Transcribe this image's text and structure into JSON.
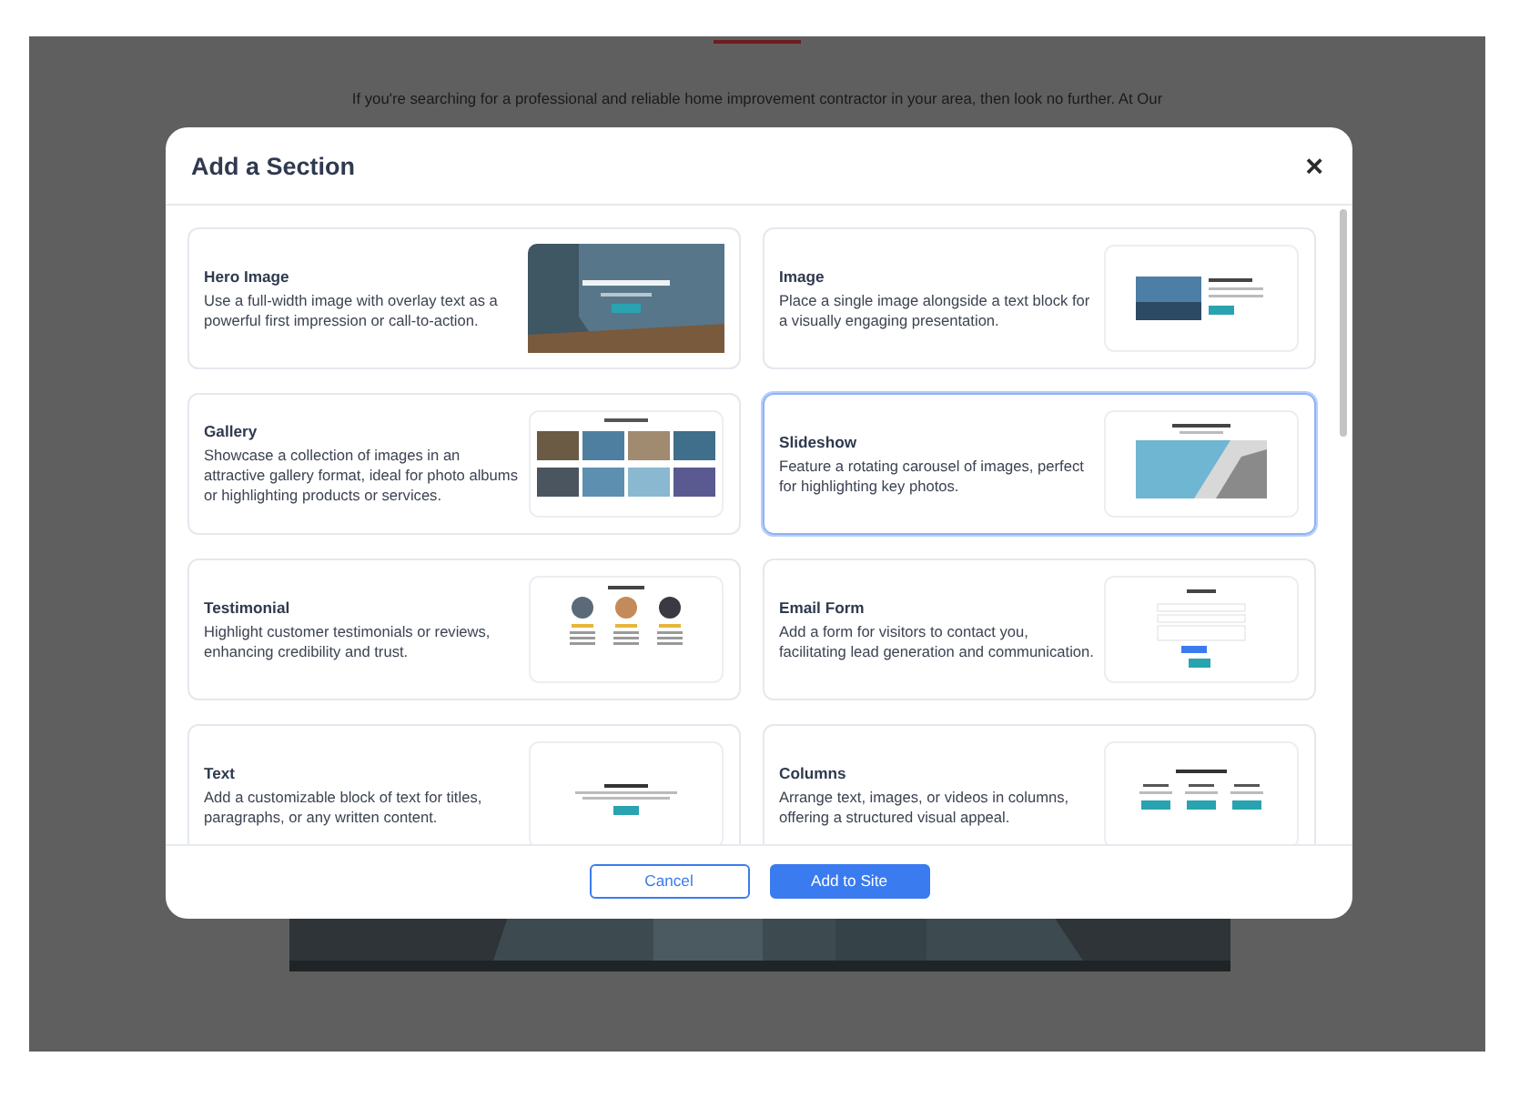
{
  "page": {
    "paragraph": "If you're searching for a professional and reliable home improvement contractor in your area, then look no further. At Our"
  },
  "dialog": {
    "title": "Add a Section",
    "close": "×",
    "sections": [
      {
        "title": "Hero Image",
        "description": "Use a full-width image with overlay text as a powerful first impression or call-to-action.",
        "kind": "hero",
        "selected": false
      },
      {
        "title": "Image",
        "description": "Place a single image alongside a text block for a visually engaging presentation.",
        "selected": false
      },
      {
        "title": "Gallery",
        "description": "Showcase a collection of images in an attractive gallery format, ideal for photo albums or highlighting products or services.",
        "kind": "gallery",
        "selected": false
      },
      {
        "title": "Slideshow",
        "description": "Feature a rotating carousel of images, perfect for highlighting key photos.",
        "kind": "slideshow",
        "selected": true
      },
      {
        "title": "Testimonial",
        "description": "Highlight customer testimonials or reviews, enhancing credibility and trust.",
        "kind": "testimonial",
        "selected": false
      },
      {
        "title": "Email Form",
        "description": "Add a form for visitors to contact you, facilitating lead generation and communication.",
        "kind": "form",
        "selected": false
      },
      {
        "title": "Text",
        "description": "Add a customizable block of text for titles, paragraphs, or any written content.",
        "kind": "text",
        "selected": false
      },
      {
        "title": "Columns",
        "description": "Arrange text, images, or videos in columns, offering a structured visual appeal.",
        "kind": "columns",
        "selected": false
      }
    ],
    "buttons": [
      {
        "label": "Cancel",
        "kind": "secondary"
      },
      {
        "label": "Add to Site",
        "kind": "primary"
      }
    ]
  }
}
